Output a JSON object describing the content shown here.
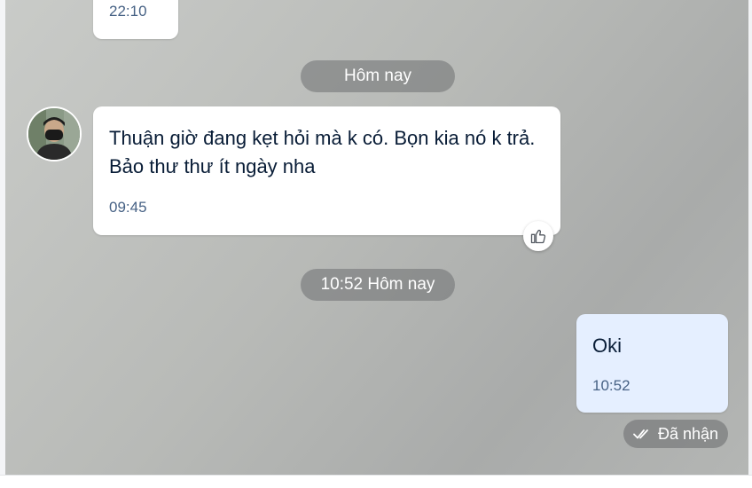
{
  "colors": {
    "bubble_incoming": "#ffffff",
    "bubble_outgoing": "#e5efff",
    "text": "#081c36",
    "time_text": "#476285",
    "pill_bg": "#6e7071"
  },
  "messages": {
    "previous": {
      "time": "22:10"
    },
    "date_separator_1": "Hôm nay",
    "incoming": {
      "avatar_icon": "user-avatar-photo",
      "text": "Thuận giờ đang kẹt hỏi mà k có. Bọn kia nó k trả. Bảo thư thư ít ngày nha",
      "time": "09:45",
      "reaction_icon": "thumbs-up-icon"
    },
    "date_separator_2": "10:52 Hôm nay",
    "outgoing": {
      "text": "Oki",
      "time": "10:52",
      "status_icon": "double-check-icon",
      "status": "Đã nhận"
    }
  }
}
